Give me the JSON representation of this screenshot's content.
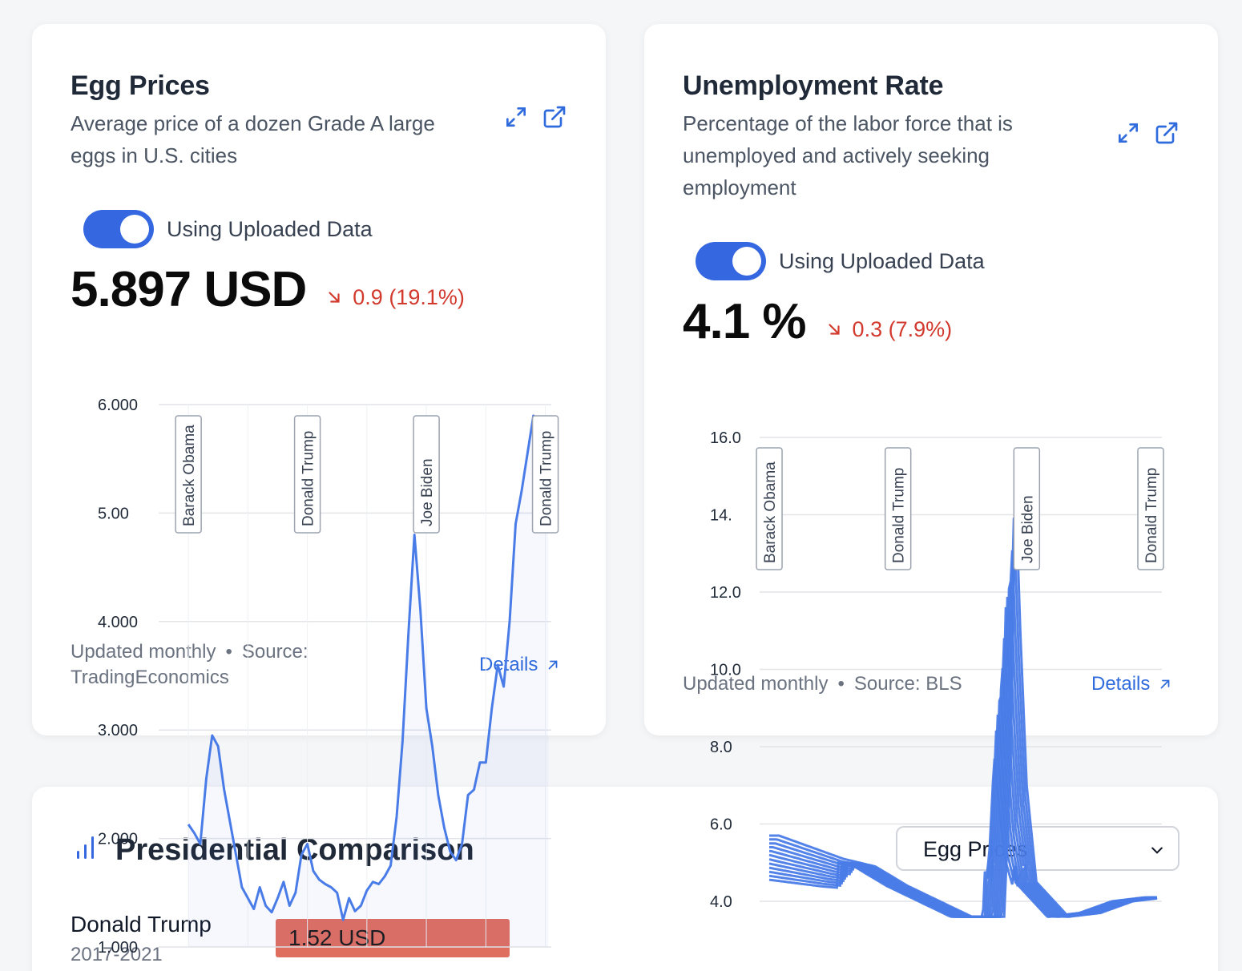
{
  "egg_card": {
    "title": "Egg Prices",
    "description_line1": "Average price of a dozen Grade A large",
    "description_line2": "eggs in U.S. cities",
    "toggle_label": "Using Uploaded Data",
    "value": "5.897 USD",
    "change": "0.9 (19.1%)",
    "footer_updated": "Updated monthly",
    "footer_source_label": "Source:",
    "footer_source": "TradingEconomics",
    "details_label": "Details"
  },
  "unemp_card": {
    "title": "Unemployment Rate",
    "description_line1": "Percentage of the labor force that is",
    "description_line2": "unemployed and actively seeking",
    "description_line3": "employment",
    "toggle_label": "Using Uploaded Data",
    "value": "4.1 %",
    "change": "0.3 (7.9%)",
    "footer_updated": "Updated monthly",
    "footer_source": "Source: BLS",
    "details_label": "Details"
  },
  "presidential": {
    "title": "Presidential Comparison",
    "select_value": "Egg Prices",
    "row_name": "Donald Trump",
    "row_years": "2017-2021",
    "row_value": "1.52 USD"
  },
  "colors": {
    "accent": "#3567e0",
    "line": "#4a7ce8",
    "negative": "#d23a2e",
    "bar": "#e06e5f"
  },
  "icons": [
    "expand-icon",
    "external-link-icon",
    "arrow-down-right-icon",
    "arrow-up-right-icon",
    "bar-chart-icon",
    "chevron-down-icon"
  ],
  "chart_data": [
    {
      "type": "line",
      "title": "",
      "ylim": [
        1,
        6
      ],
      "yticks": [
        "1.000",
        "2.000",
        "3.000",
        "4.000",
        "5.00",
        "6.000"
      ],
      "presidents": [
        "Barack Obama",
        "Donald Trump",
        "Joe Biden",
        "Donald Trump"
      ],
      "president_start_years": [
        2013,
        2017,
        2021,
        2025
      ],
      "x": [
        2013.0,
        2013.2,
        2013.4,
        2013.6,
        2013.8,
        2014.0,
        2014.2,
        2014.4,
        2014.6,
        2014.8,
        2015.0,
        2015.2,
        2015.4,
        2015.6,
        2015.8,
        2016.0,
        2016.2,
        2016.4,
        2016.6,
        2016.8,
        2017.0,
        2017.2,
        2017.4,
        2017.6,
        2017.8,
        2018.0,
        2018.2,
        2018.4,
        2018.6,
        2018.8,
        2019.0,
        2019.2,
        2019.4,
        2019.6,
        2019.8,
        2020.0,
        2020.2,
        2020.4,
        2020.6,
        2020.8,
        2021.0,
        2021.2,
        2021.4,
        2021.6,
        2021.8,
        2022.0,
        2022.2,
        2022.4,
        2022.6,
        2022.8,
        2023.0,
        2023.2,
        2023.4,
        2023.6,
        2023.8,
        2024.0,
        2024.2,
        2024.4,
        2024.6,
        2024.8,
        2025.0,
        2025.1
      ],
      "values": [
        2.13,
        2.05,
        1.95,
        2.55,
        2.95,
        2.85,
        2.45,
        2.15,
        1.85,
        1.55,
        1.45,
        1.35,
        1.55,
        1.38,
        1.32,
        1.45,
        1.6,
        1.38,
        1.5,
        1.85,
        1.95,
        1.7,
        1.62,
        1.58,
        1.55,
        1.5,
        1.25,
        1.45,
        1.33,
        1.38,
        1.52,
        1.6,
        1.58,
        1.65,
        1.75,
        2.2,
        2.9,
        3.9,
        4.8,
        4.1,
        3.2,
        2.85,
        2.4,
        2.1,
        1.88,
        1.8,
        1.95,
        2.4,
        2.45,
        2.7,
        2.7,
        3.2,
        3.6,
        3.4,
        4.0,
        4.9,
        5.2,
        5.55,
        5.897,
        5.85,
        5.2,
        5.85
      ],
      "series": [
        {
          "name": "",
          "values": []
        }
      ]
    },
    {
      "type": "line",
      "title": "",
      "ylim": [
        3,
        16
      ],
      "yticks": [
        "4.0",
        "6.0",
        "8.0",
        "10.0",
        "12.0",
        "14.",
        "16.0"
      ],
      "presidents": [
        "Barack Obama",
        "Donald Trump",
        "Joe Biden",
        "Donald Trump"
      ],
      "president_start_years": [
        2013,
        2017,
        2021,
        2025
      ],
      "x": [
        2013,
        2014,
        2015,
        2016,
        2017,
        2018,
        2019,
        2020.0,
        2020.2,
        2020.35,
        2020.5,
        2020.7,
        2021,
        2022,
        2023,
        2024,
        2025
      ],
      "values": [
        5.7,
        5.4,
        5.1,
        4.9,
        4.4,
        4.0,
        3.6,
        3.6,
        7.5,
        14.8,
        11.0,
        7.0,
        4.5,
        3.6,
        3.7,
        4.0,
        4.1
      ]
    }
  ]
}
